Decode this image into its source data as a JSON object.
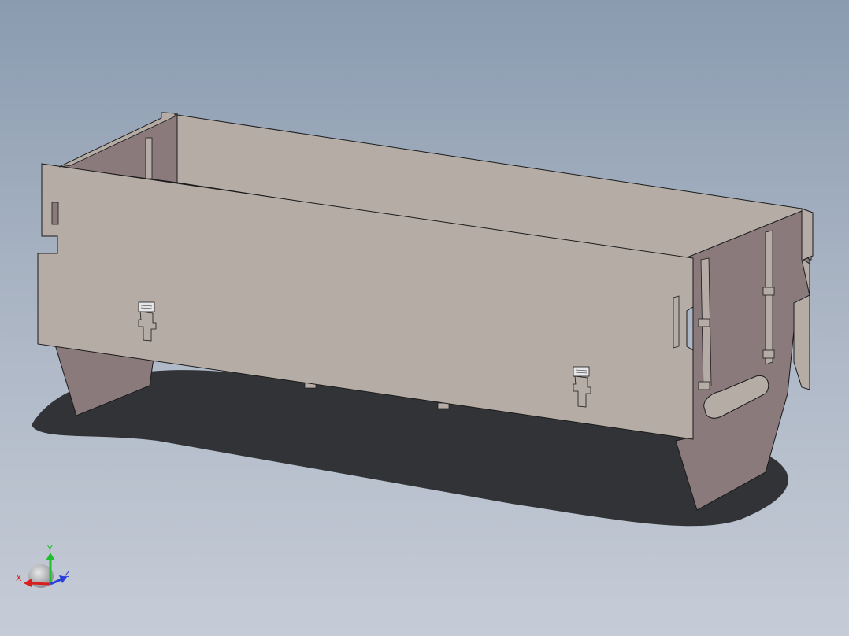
{
  "viewport": {
    "background_top": "#8a9bb0",
    "background_bottom": "#c6ccd7"
  },
  "model": {
    "panel_color": "#b5aca5",
    "end_panel_color": "#8a7a7c",
    "edge_color": "#1a1a1a",
    "shadow_color": "#2a2b2e"
  },
  "triad": {
    "x_label": "X",
    "y_label": "Y",
    "z_label": "Z",
    "x_color": "#d81f1f",
    "y_color": "#1fbf2f",
    "z_color": "#2a3fd8"
  }
}
